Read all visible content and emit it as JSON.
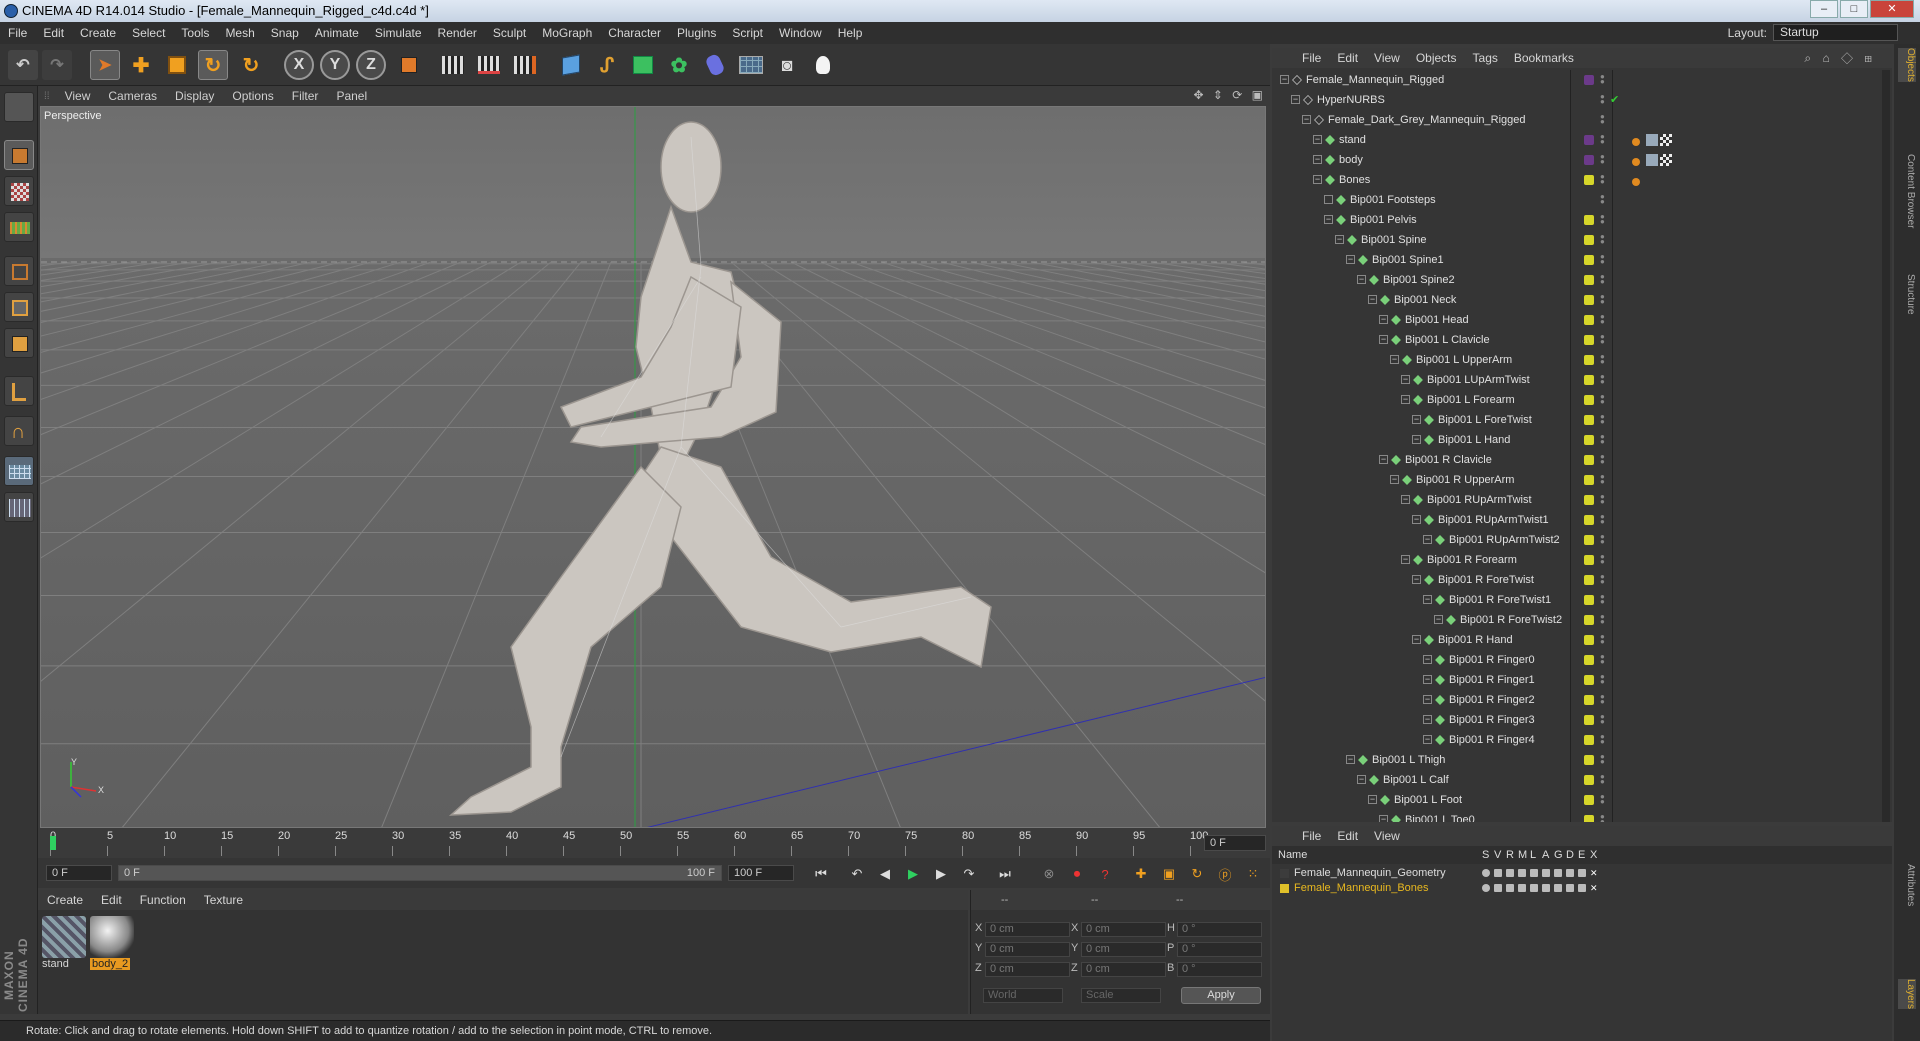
{
  "window": {
    "title": "CINEMA 4D R14.014 Studio - [Female_Mannequin_Rigged_c4d.c4d *]"
  },
  "menubar": [
    "File",
    "Edit",
    "Create",
    "Select",
    "Tools",
    "Mesh",
    "Snap",
    "Animate",
    "Simulate",
    "Render",
    "Sculpt",
    "MoGraph",
    "Character",
    "Plugins",
    "Script",
    "Window",
    "Help"
  ],
  "layout": {
    "label": "Layout:",
    "value": "Startup"
  },
  "toolbar": {
    "x_label": "X",
    "y_label": "Y",
    "z_label": "Z"
  },
  "viewport": {
    "menu": [
      "View",
      "Cameras",
      "Display",
      "Options",
      "Filter",
      "Panel"
    ],
    "label": "Perspective",
    "axis_y": "Y",
    "axis_x": "X"
  },
  "timeline": {
    "ticks": [
      "0",
      "5",
      "10",
      "15",
      "20",
      "25",
      "30",
      "35",
      "40",
      "45",
      "50",
      "55",
      "60",
      "65",
      "70",
      "75",
      "80",
      "85",
      "90",
      "95",
      "100"
    ],
    "frame": "0 F",
    "start": "0 F",
    "range_start": "0 F",
    "range_end": "100 F",
    "end": "100 F"
  },
  "materials": {
    "menu": [
      "Create",
      "Edit",
      "Function",
      "Texture"
    ],
    "items": [
      {
        "name": "stand"
      },
      {
        "name": "body_2"
      }
    ]
  },
  "coords": {
    "header": [
      "--",
      "--",
      "--"
    ],
    "rows": [
      {
        "a": "X",
        "v1": "0 cm",
        "b": "X",
        "v2": "0 cm",
        "c": "H",
        "v3": "0 °"
      },
      {
        "a": "Y",
        "v1": "0 cm",
        "b": "Y",
        "v2": "0 cm",
        "c": "P",
        "v3": "0 °"
      },
      {
        "a": "Z",
        "v1": "0 cm",
        "b": "Z",
        "v2": "0 cm",
        "c": "B",
        "v3": "0 °"
      }
    ],
    "world": "World",
    "scale": "Scale",
    "apply": "Apply"
  },
  "status": "Rotate: Click and drag to rotate elements. Hold down SHIFT to add to quantize rotation / add to the selection in point mode, CTRL to remove.",
  "maxon": "MAXON CINEMA 4D",
  "objects": {
    "menu": [
      "File",
      "Edit",
      "View",
      "Objects",
      "Tags",
      "Bookmarks"
    ],
    "rows": [
      {
        "name": "Female_Mannequin_Rigged",
        "depth": 0,
        "tag": "#6b3a8a"
      },
      {
        "name": "HyperNURBS",
        "depth": 1,
        "tag": "",
        "check": "✔"
      },
      {
        "name": "Female_Dark_Grey_Mannequin_Rigged",
        "depth": 2,
        "tag": ""
      },
      {
        "name": "stand",
        "depth": 3,
        "tag": "#6b3a8a"
      },
      {
        "name": "body",
        "depth": 3,
        "tag": "#6b3a8a"
      },
      {
        "name": "Bones",
        "depth": 3,
        "tag": "#d6d62a"
      },
      {
        "name": "Bip001 Footsteps",
        "depth": 4,
        "tag": ""
      },
      {
        "name": "Bip001 Pelvis",
        "depth": 4,
        "tag": "#d6d62a"
      },
      {
        "name": "Bip001 Spine",
        "depth": 5,
        "tag": "#d6d62a"
      },
      {
        "name": "Bip001 Spine1",
        "depth": 6,
        "tag": "#d6d62a"
      },
      {
        "name": "Bip001 Spine2",
        "depth": 7,
        "tag": "#d6d62a"
      },
      {
        "name": "Bip001 Neck",
        "depth": 8,
        "tag": "#d6d62a"
      },
      {
        "name": "Bip001 Head",
        "depth": 9,
        "tag": "#d6d62a"
      },
      {
        "name": "Bip001 L Clavicle",
        "depth": 9,
        "tag": "#d6d62a"
      },
      {
        "name": "Bip001 L UpperArm",
        "depth": 10,
        "tag": "#d6d62a"
      },
      {
        "name": "Bip001 LUpArmTwist",
        "depth": 11,
        "tag": "#d6d62a"
      },
      {
        "name": "Bip001 L Forearm",
        "depth": 11,
        "tag": "#d6d62a"
      },
      {
        "name": "Bip001 L ForeTwist",
        "depth": 12,
        "tag": "#d6d62a"
      },
      {
        "name": "Bip001 L Hand",
        "depth": 12,
        "tag": "#d6d62a"
      },
      {
        "name": "Bip001 R Clavicle",
        "depth": 9,
        "tag": "#d6d62a"
      },
      {
        "name": "Bip001 R UpperArm",
        "depth": 10,
        "tag": "#d6d62a"
      },
      {
        "name": "Bip001 RUpArmTwist",
        "depth": 11,
        "tag": "#d6d62a"
      },
      {
        "name": "Bip001 RUpArmTwist1",
        "depth": 12,
        "tag": "#d6d62a"
      },
      {
        "name": "Bip001 RUpArmTwist2",
        "depth": 13,
        "tag": "#d6d62a"
      },
      {
        "name": "Bip001 R Forearm",
        "depth": 11,
        "tag": "#d6d62a"
      },
      {
        "name": "Bip001 R ForeTwist",
        "depth": 12,
        "tag": "#d6d62a"
      },
      {
        "name": "Bip001 R ForeTwist1",
        "depth": 13,
        "tag": "#d6d62a"
      },
      {
        "name": "Bip001 R ForeTwist2",
        "depth": 14,
        "tag": "#d6d62a"
      },
      {
        "name": "Bip001 R Hand",
        "depth": 12,
        "tag": "#d6d62a"
      },
      {
        "name": "Bip001 R Finger0",
        "depth": 13,
        "tag": "#d6d62a"
      },
      {
        "name": "Bip001 R Finger1",
        "depth": 13,
        "tag": "#d6d62a"
      },
      {
        "name": "Bip001 R Finger2",
        "depth": 13,
        "tag": "#d6d62a"
      },
      {
        "name": "Bip001 R Finger3",
        "depth": 13,
        "tag": "#d6d62a"
      },
      {
        "name": "Bip001 R Finger4",
        "depth": 13,
        "tag": "#d6d62a"
      },
      {
        "name": "Bip001 L Thigh",
        "depth": 6,
        "tag": "#d6d62a"
      },
      {
        "name": "Bip001 L Calf",
        "depth": 7,
        "tag": "#d6d62a"
      },
      {
        "name": "Bip001 L Foot",
        "depth": 8,
        "tag": "#d6d62a"
      },
      {
        "name": "Bip001 L Toe0",
        "depth": 9,
        "tag": "#d6d62a"
      }
    ]
  },
  "layers": {
    "menu": [
      "File",
      "Edit",
      "View"
    ],
    "cols": [
      "Name",
      "S",
      "V",
      "R",
      "M",
      "L",
      "A",
      "G",
      "D",
      "E",
      "X"
    ],
    "rows": [
      {
        "name": "Female_Mannequin_Geometry",
        "color": "#3c3c3c"
      },
      {
        "name": "Female_Mannequin_Bones",
        "color": "#e0c12a"
      }
    ]
  },
  "sidetabs": [
    "Objects",
    "Content Browser",
    "Structure",
    "Attributes",
    "Layers"
  ]
}
